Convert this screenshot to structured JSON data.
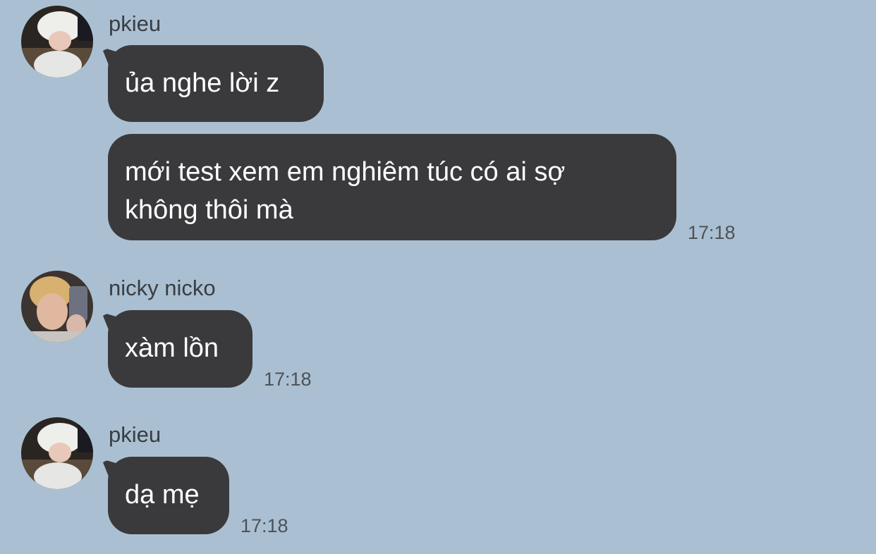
{
  "messages": [
    {
      "sender": "pkieu",
      "bubbles": [
        "ủa nghe lời z",
        "mới test xem em nghiêm túc có ai sợ\nkhông thôi mà"
      ],
      "time": "17:18"
    },
    {
      "sender": "nicky nicko",
      "bubbles": [
        "xàm lồn"
      ],
      "time": "17:18"
    },
    {
      "sender": "pkieu",
      "bubbles": [
        "dạ mẹ"
      ],
      "time": "17:18"
    }
  ],
  "colors": {
    "background": "#aac0d2",
    "bubble": "#3a3a3c",
    "bubble_text": "#ffffff",
    "meta_text": "#4d5257"
  }
}
